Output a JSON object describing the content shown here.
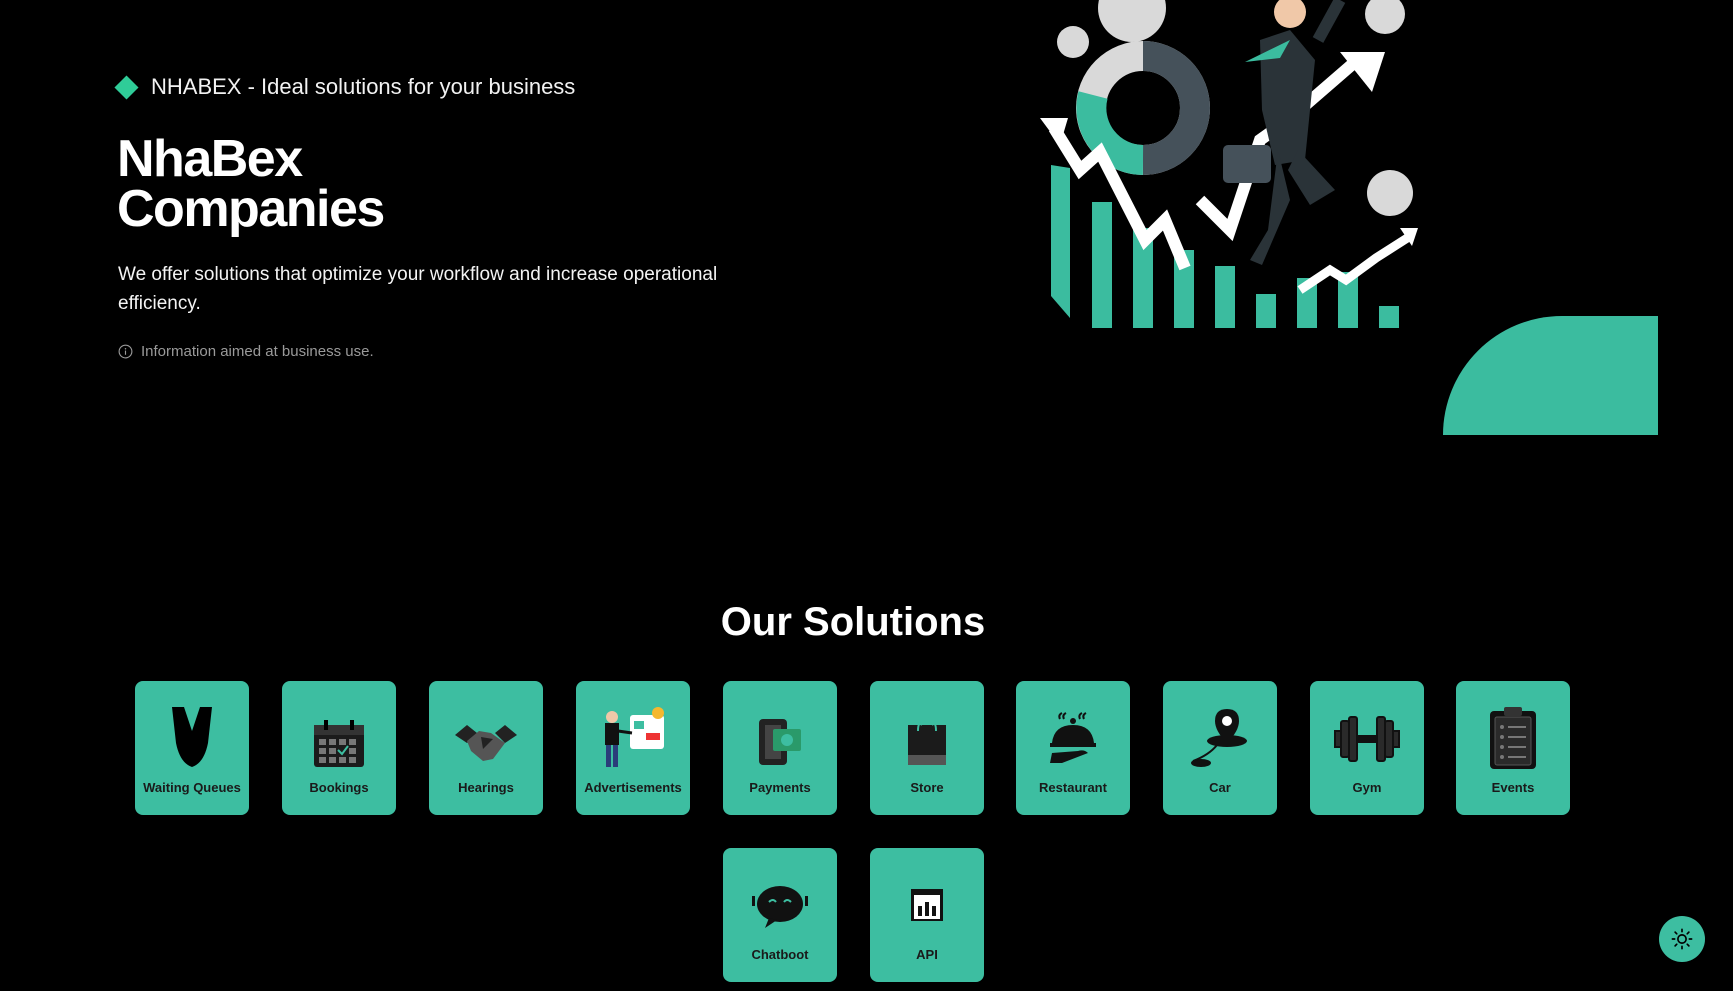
{
  "hero": {
    "tagline": "NHABEX - Ideal solutions for your business",
    "title_line1": "NhaBex",
    "title_line2": "Companies",
    "description": "We offer solutions that optimize your workflow and increase operational efficiency.",
    "note": "Information aimed at business use."
  },
  "solutions": {
    "title": "Our Solutions",
    "items": [
      {
        "label": "Waiting Queues",
        "icon": "waiting-queues-icon"
      },
      {
        "label": "Bookings",
        "icon": "calendar-icon"
      },
      {
        "label": "Hearings",
        "icon": "handshake-icon"
      },
      {
        "label": "Advertisements",
        "icon": "advertisement-icon"
      },
      {
        "label": "Payments",
        "icon": "payment-icon"
      },
      {
        "label": "Store",
        "icon": "shopping-bag-icon"
      },
      {
        "label": "Restaurant",
        "icon": "serving-dish-icon"
      },
      {
        "label": "Car",
        "icon": "location-pin-icon"
      },
      {
        "label": "Gym",
        "icon": "dumbbell-icon"
      },
      {
        "label": "Events",
        "icon": "clipboard-icon"
      },
      {
        "label": "Chatboot",
        "icon": "chatbot-icon"
      },
      {
        "label": "API",
        "icon": "api-icon"
      }
    ]
  },
  "colors": {
    "accent": "#3dbea1",
    "diamond": "#2fcc98",
    "background": "#000000"
  },
  "theme_toggle": {
    "icon": "sun-icon"
  }
}
